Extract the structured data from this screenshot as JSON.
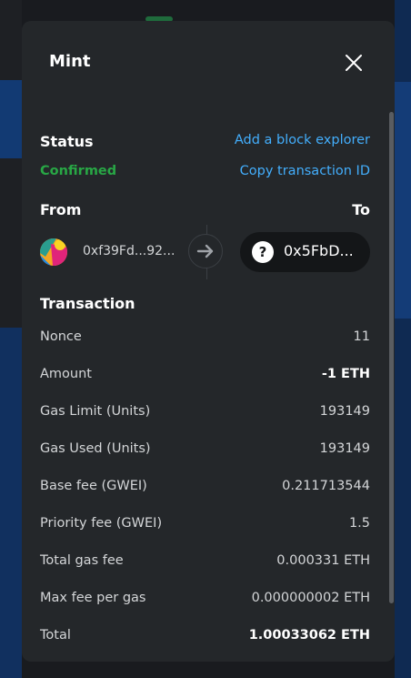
{
  "modal": {
    "title": "Mint",
    "close_icon": "close-icon"
  },
  "status": {
    "label": "Status",
    "value": "Confirmed",
    "value_color": "#28a745",
    "add_explorer_link": "Add a block explorer",
    "copy_tx_link": "Copy transaction ID"
  },
  "parties": {
    "from_label": "From",
    "to_label": "To",
    "from_address": "0xf39Fd...92...",
    "to_address": "0x5FbD...",
    "to_icon_glyph": "?"
  },
  "transaction": {
    "title": "Transaction",
    "rows": [
      {
        "label": "Nonce",
        "value": "11"
      },
      {
        "label": "Amount",
        "value": "-1 ETH"
      },
      {
        "label": "Gas Limit (Units)",
        "value": "193149"
      },
      {
        "label": "Gas Used (Units)",
        "value": "193149"
      },
      {
        "label": "Base fee (GWEI)",
        "value": "0.211713544"
      },
      {
        "label": "Priority fee (GWEI)",
        "value": "1.5"
      },
      {
        "label": "Total gas fee",
        "value": "0.000331 ETH"
      },
      {
        "label": "Max fee per gas",
        "value": "0.000000002 ETH"
      },
      {
        "label": "Total",
        "value": "1.00033062 ETH"
      }
    ]
  },
  "colors": {
    "accent_link": "#43aefc",
    "modal_bg": "#24272a"
  }
}
